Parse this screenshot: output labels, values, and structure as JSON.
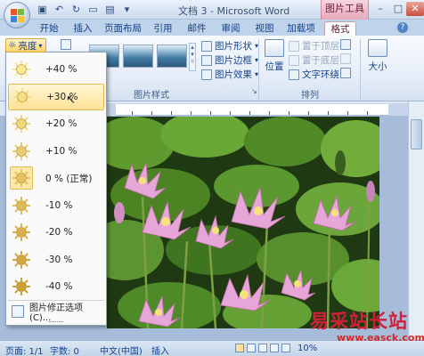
{
  "window": {
    "title": "文档 3 - Microsoft Word",
    "context_tab": "图片工具"
  },
  "tabs": [
    "开始",
    "插入",
    "页面布局",
    "引用",
    "邮件",
    "审阅",
    "视图",
    "加载项",
    "格式"
  ],
  "ribbon": {
    "brightness_button": "亮度",
    "picture_styles_label": "图片样式",
    "picture_shape": "图片形状",
    "picture_border": "图片边框",
    "picture_effects": "图片效果",
    "position": "位置",
    "bring_front": "置于顶层",
    "send_back": "置于底层",
    "text_wrap": "文字环绕",
    "arrange_label": "排列",
    "size": "大小"
  },
  "brightness_menu": {
    "items": [
      {
        "label": "+40 %",
        "level": 0.9
      },
      {
        "label": "+30 %",
        "level": 0.8
      },
      {
        "label": "+20 %",
        "level": 0.7
      },
      {
        "label": "+10 %",
        "level": 0.6
      },
      {
        "label": "0 % (正常)",
        "level": 0.5
      },
      {
        "label": "-10 %",
        "level": 0.4
      },
      {
        "label": "-20 %",
        "level": 0.3
      },
      {
        "label": "-30 %",
        "level": 0.2
      },
      {
        "label": "-40 %",
        "level": 0.1
      }
    ],
    "hover_index": 1,
    "current_index": 4,
    "footer": "图片修正选项(C)..."
  },
  "statusbar": {
    "page": "页面: 1/1",
    "words": "字数: 0",
    "language": "中文(中国)",
    "insert_mode": "插入",
    "zoom": "10%"
  },
  "watermark": {
    "cn": "易采站长站",
    "url": "www.easck.com"
  },
  "colors": {
    "hover": "#ffe296",
    "accent": "#15428b",
    "watermark": "#d0203a"
  }
}
